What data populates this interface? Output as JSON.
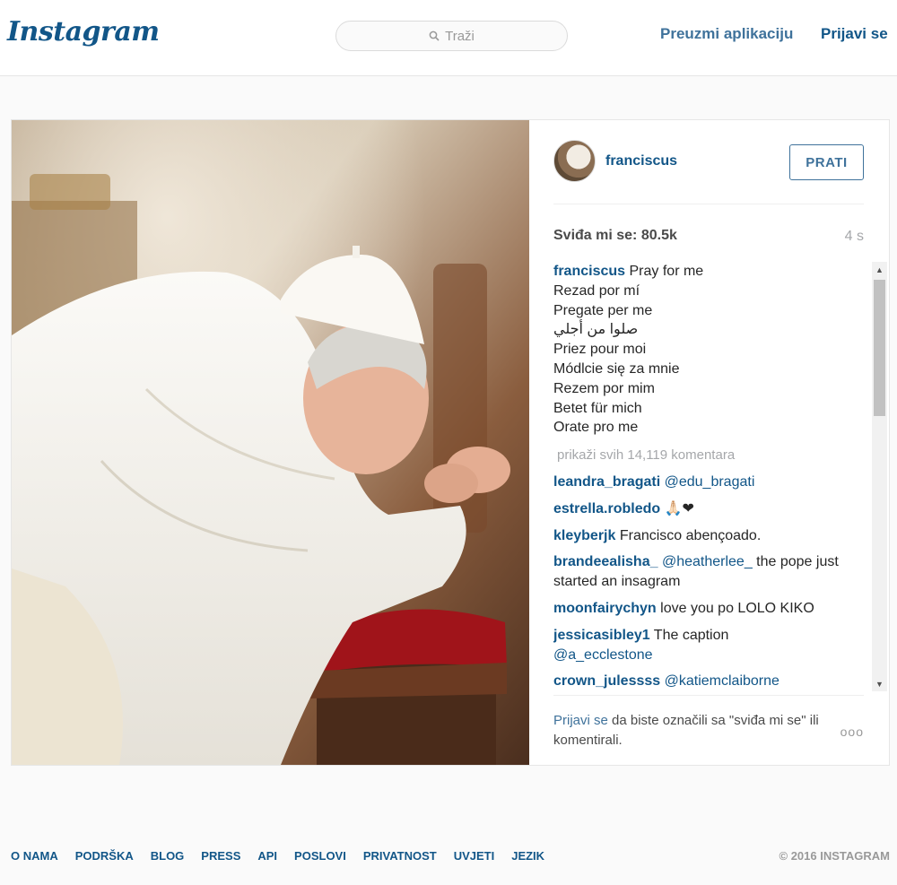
{
  "header": {
    "logo": "Instagram",
    "search_placeholder": "Traži",
    "download_app": "Preuzmi aplikaciju",
    "login": "Prijavi se"
  },
  "post": {
    "image_description": "Pope Francis praying, kneeling at a red kneeler",
    "username": "franciscus",
    "follow_label": "PRATI",
    "likes": "Sviđa mi se: 80.5k",
    "time_ago": "4 s",
    "caption": {
      "user": "franciscus",
      "lines": [
        "Pray for me",
        "Rezad por mí",
        "Pregate per me",
        "صلوا من أجلي",
        "Priez pour moi",
        "Módlcie się za mnie",
        "Rezem por mim",
        "Betet für mich",
        "Orate pro me"
      ]
    },
    "view_all_comments": "prikaži svih 14,119 komentara",
    "comments": [
      {
        "user": "leandra_bragati",
        "mention": "@edu_bragati",
        "text": ""
      },
      {
        "user": "estrella.robledo",
        "mention": "",
        "text": "🙏🏻❤"
      },
      {
        "user": "kleyberjk",
        "mention": "",
        "text": "Francisco abençoado."
      },
      {
        "user": "brandeealisha_",
        "mention": "@heatherlee_",
        "text": "the pope just started an insagram"
      },
      {
        "user": "moonfairychyn",
        "mention": "",
        "text": "love you po LOLO KIKO"
      },
      {
        "user": "jessicasibley1",
        "mention": "",
        "text": "The caption",
        "mention_after": "@a_ecclestone"
      },
      {
        "user": "crown_julessss",
        "mention": "@katiemclaiborne",
        "text": ""
      }
    ],
    "login_prompt_link": "Prijavi se",
    "login_prompt_text": " da biste označili sa \"sviđa mi se\" ili komentirali.",
    "more_options": "ooo"
  },
  "footer": {
    "links": [
      "O NAMA",
      "PODRŠKA",
      "BLOG",
      "PRESS",
      "API",
      "POSLOVI",
      "PRIVATNOST",
      "UVJETI",
      "JEZIK"
    ],
    "copyright": "© 2016 INSTAGRAM"
  },
  "colors": {
    "brand_blue": "#125688",
    "link_blue": "#3f729b",
    "muted_gray": "#a5a7aa",
    "background": "#fafafa"
  }
}
